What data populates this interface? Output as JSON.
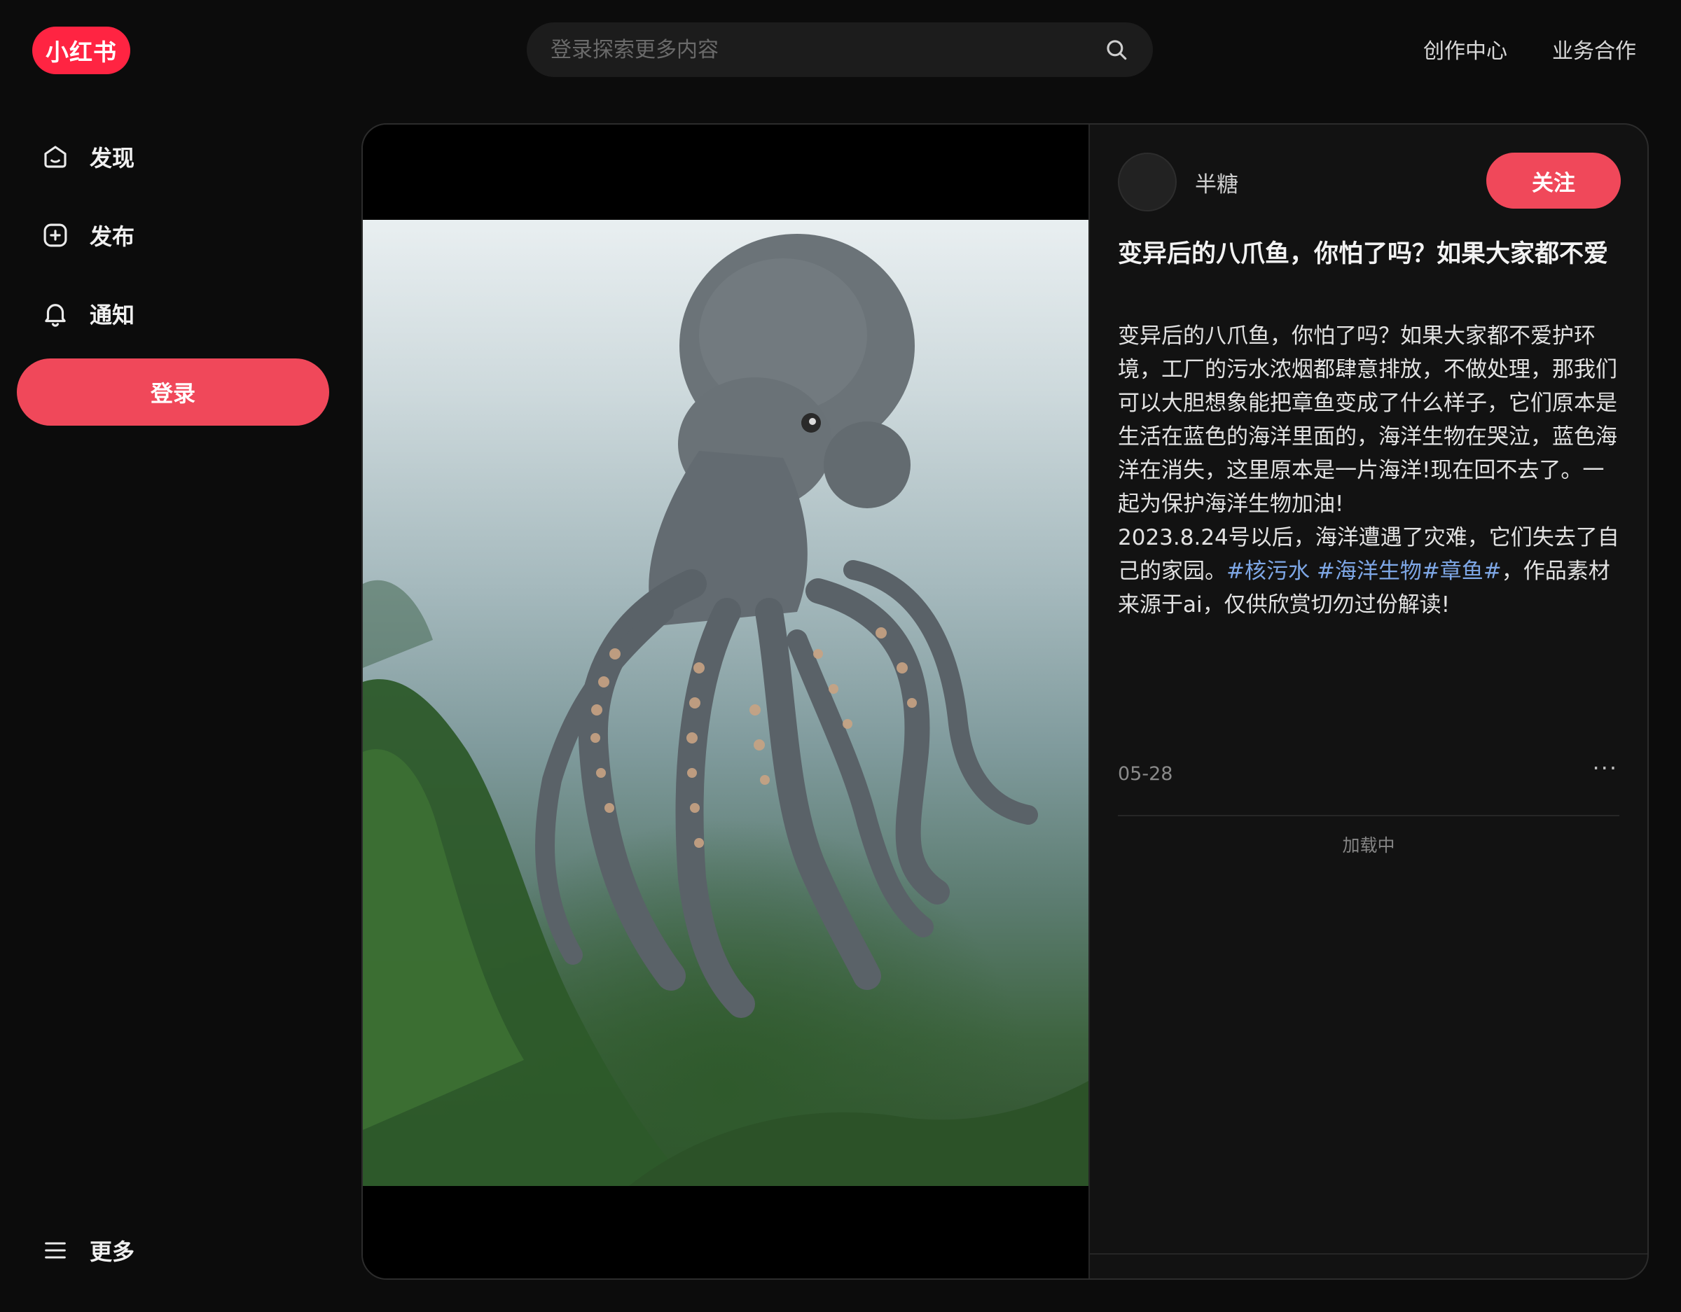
{
  "header": {
    "logo_text": "小红书",
    "search_placeholder": "登录探索更多内容",
    "links": [
      "创作中心",
      "业务合作"
    ]
  },
  "sidebar": {
    "items": [
      {
        "label": "发现",
        "icon": "home-icon"
      },
      {
        "label": "发布",
        "icon": "plus-square-icon"
      },
      {
        "label": "通知",
        "icon": "bell-icon"
      }
    ],
    "login_label": "登录",
    "more_label": "更多"
  },
  "note": {
    "author": "半糖",
    "follow_label": "关注",
    "title": "变异后的八爪鱼，你怕了吗？如果大家都不爱",
    "desc_text": "变异后的八爪鱼，你怕了吗？如果大家都不爱护环境，工厂的污水浓烟都肆意排放，不做处理，那我们可以大胆想象能把章鱼变成了什么样子，它们原本是生活在蓝色的海洋里面的，海洋生物在哭泣，蓝色海洋在消失，这里原本是一片海洋!现在回不去了。一起为保护海洋生物加油!",
    "desc_line2_prefix": "2023.8.24号以后，海洋遭遇了灾难，它们失去了自己的家园。",
    "tags": [
      "#核污水",
      "#海洋生物",
      "#章鱼#"
    ],
    "desc_suffix": "，作品素材来源于ai，仅供欣赏切勿过份解读!",
    "date": "05-28",
    "more": "···",
    "loading": "加载中"
  },
  "colors": {
    "brand": "#ff2442",
    "button": "#f0485a",
    "tag": "#7ea7e6",
    "background": "#0c0c0c"
  }
}
